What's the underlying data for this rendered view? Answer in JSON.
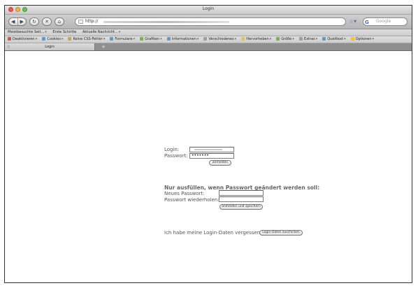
{
  "window": {
    "title": "Login"
  },
  "toolbar": {
    "back_icon": "back-arrow-icon",
    "forward_icon": "forward-arrow-icon",
    "url_prefix": "http://",
    "search_placeholder": "Google"
  },
  "bookmarks_top": [
    {
      "label": "Meistbesuchte Seit...",
      "caret": true
    },
    {
      "label": "Erste Schritte",
      "caret": false
    },
    {
      "label": "Aktuelle Nachricht...",
      "caret": true
    }
  ],
  "bookmarks_dev": [
    {
      "label": "Deaktivieren",
      "color": "#d9534f"
    },
    {
      "label": "Cookies",
      "color": "#5b9bd5"
    },
    {
      "label": "Keine CSS-Fehler",
      "color": "#c8a94a"
    },
    {
      "label": "Formulare",
      "color": "#5b9bd5"
    },
    {
      "label": "Grafiken",
      "color": "#7cb342"
    },
    {
      "label": "Informationen",
      "color": "#5b9bd5"
    },
    {
      "label": "Verschiedenes",
      "color": "#9e9e9e"
    },
    {
      "label": "Hervorheben",
      "color": "#f1c232"
    },
    {
      "label": "Größe",
      "color": "#7cb342"
    },
    {
      "label": "Extras",
      "color": "#9e9e9e"
    },
    {
      "label": "Quelltext",
      "color": "#5b9bd5"
    },
    {
      "label": "Optionen",
      "color": "#f1c232"
    }
  ],
  "tabs": [
    {
      "label": "Login"
    }
  ],
  "form": {
    "login_label": "Login:",
    "password_label": "Passwort:",
    "password_value": "•••••••",
    "login_button": "anmelden",
    "change_heading": "Nur ausfüllen, wenn Passwort geändert werden soll:",
    "new_password_label": "Neues Passwort:",
    "repeat_password_label": "Passwort wiederholen:",
    "save_button": "anmelden und speichern",
    "forgot_text": "Ich habe meine Login-Daten vergessen:",
    "forgot_button": "Login-Daten zuschicken"
  }
}
